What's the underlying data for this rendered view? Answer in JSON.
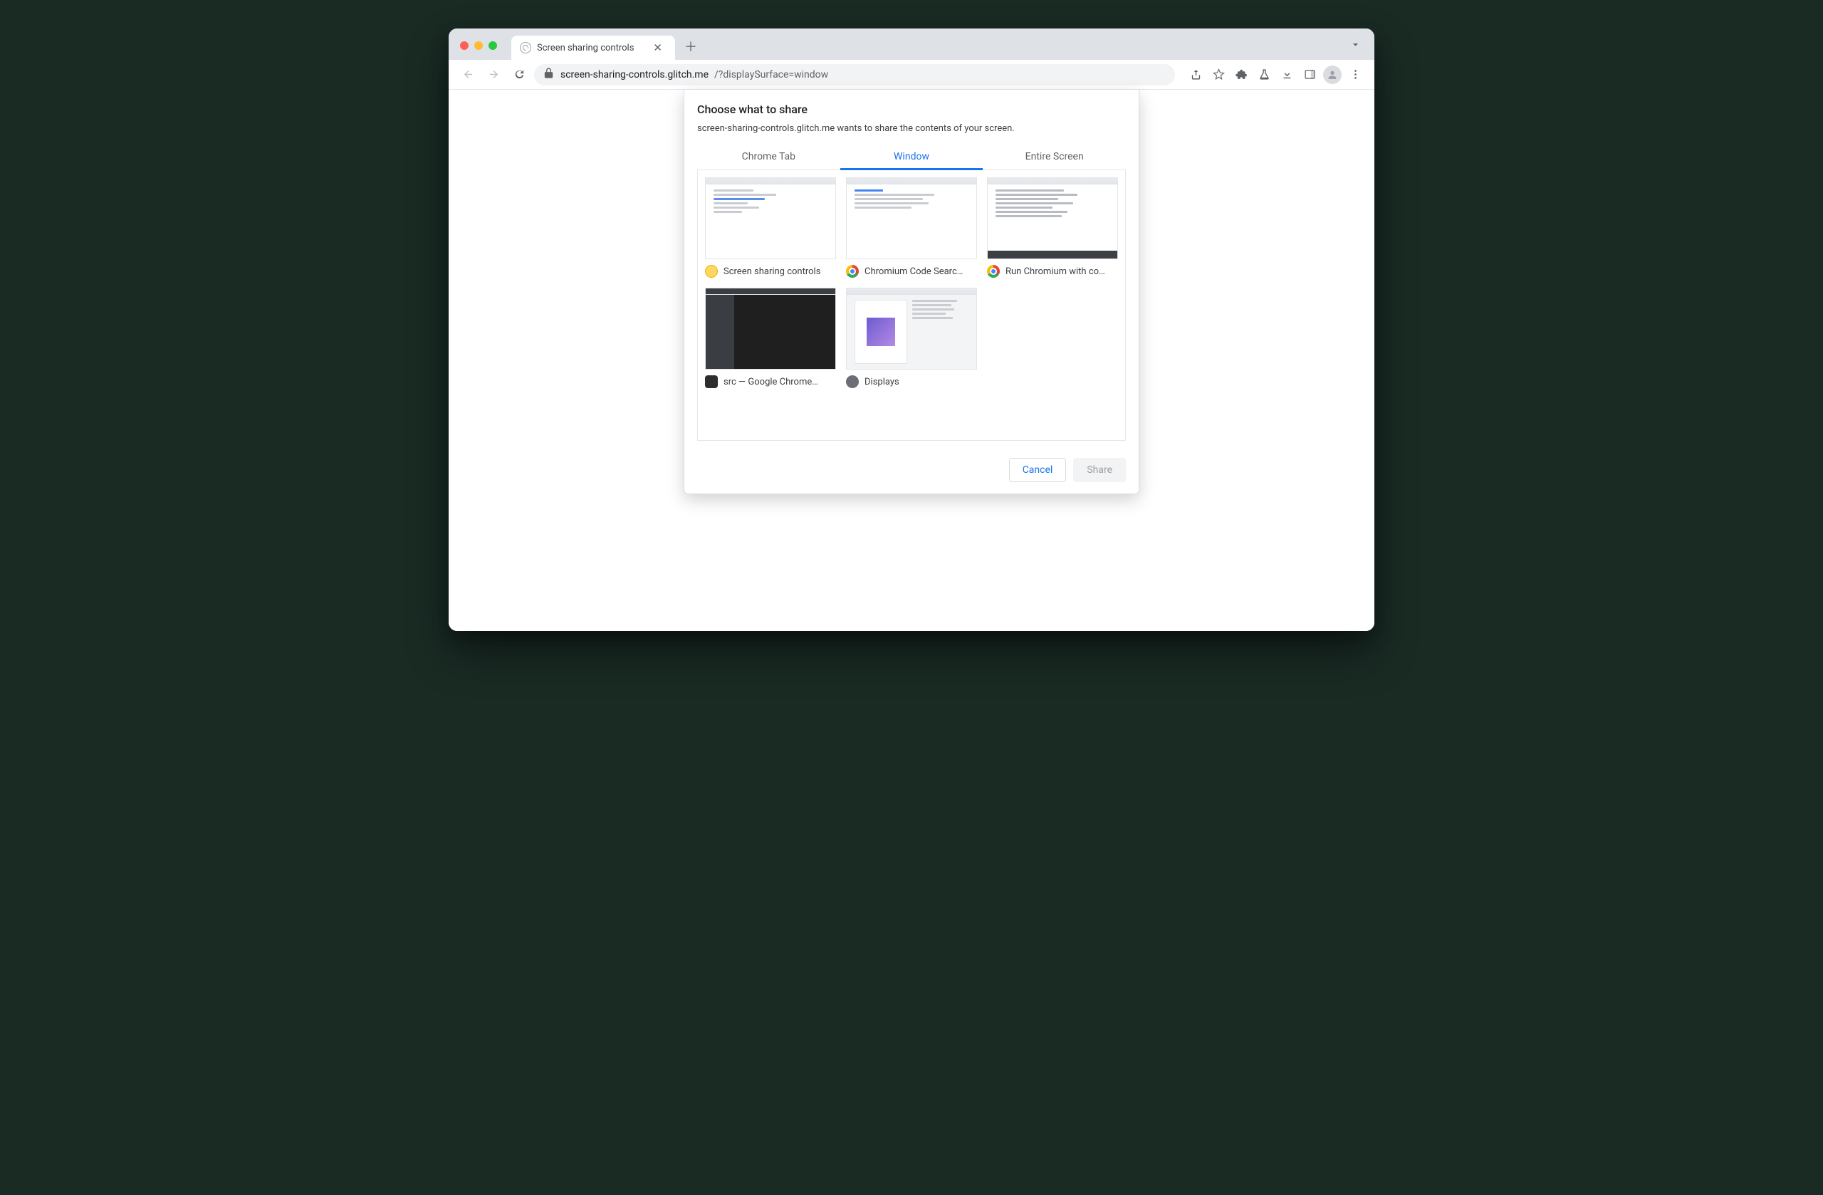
{
  "tab": {
    "title": "Screen sharing controls"
  },
  "omnibox": {
    "host": "screen-sharing-controls.glitch.me",
    "path": "/?displaySurface=window"
  },
  "modal": {
    "title": "Choose what to share",
    "subtitle": "screen-sharing-controls.glitch.me wants to share the contents of your screen.",
    "tabs": {
      "chrome_tab": "Chrome Tab",
      "window": "Window",
      "entire_screen": "Entire Screen"
    },
    "windows": [
      {
        "label": "Screen sharing controls",
        "app": "canary"
      },
      {
        "label": "Chromium Code Searc…",
        "app": "chrome"
      },
      {
        "label": "Run Chromium with co…",
        "app": "chrome"
      },
      {
        "label": "src — Google Chrome…",
        "app": "term"
      },
      {
        "label": "Displays",
        "app": "sys"
      }
    ],
    "buttons": {
      "cancel": "Cancel",
      "share": "Share"
    }
  }
}
